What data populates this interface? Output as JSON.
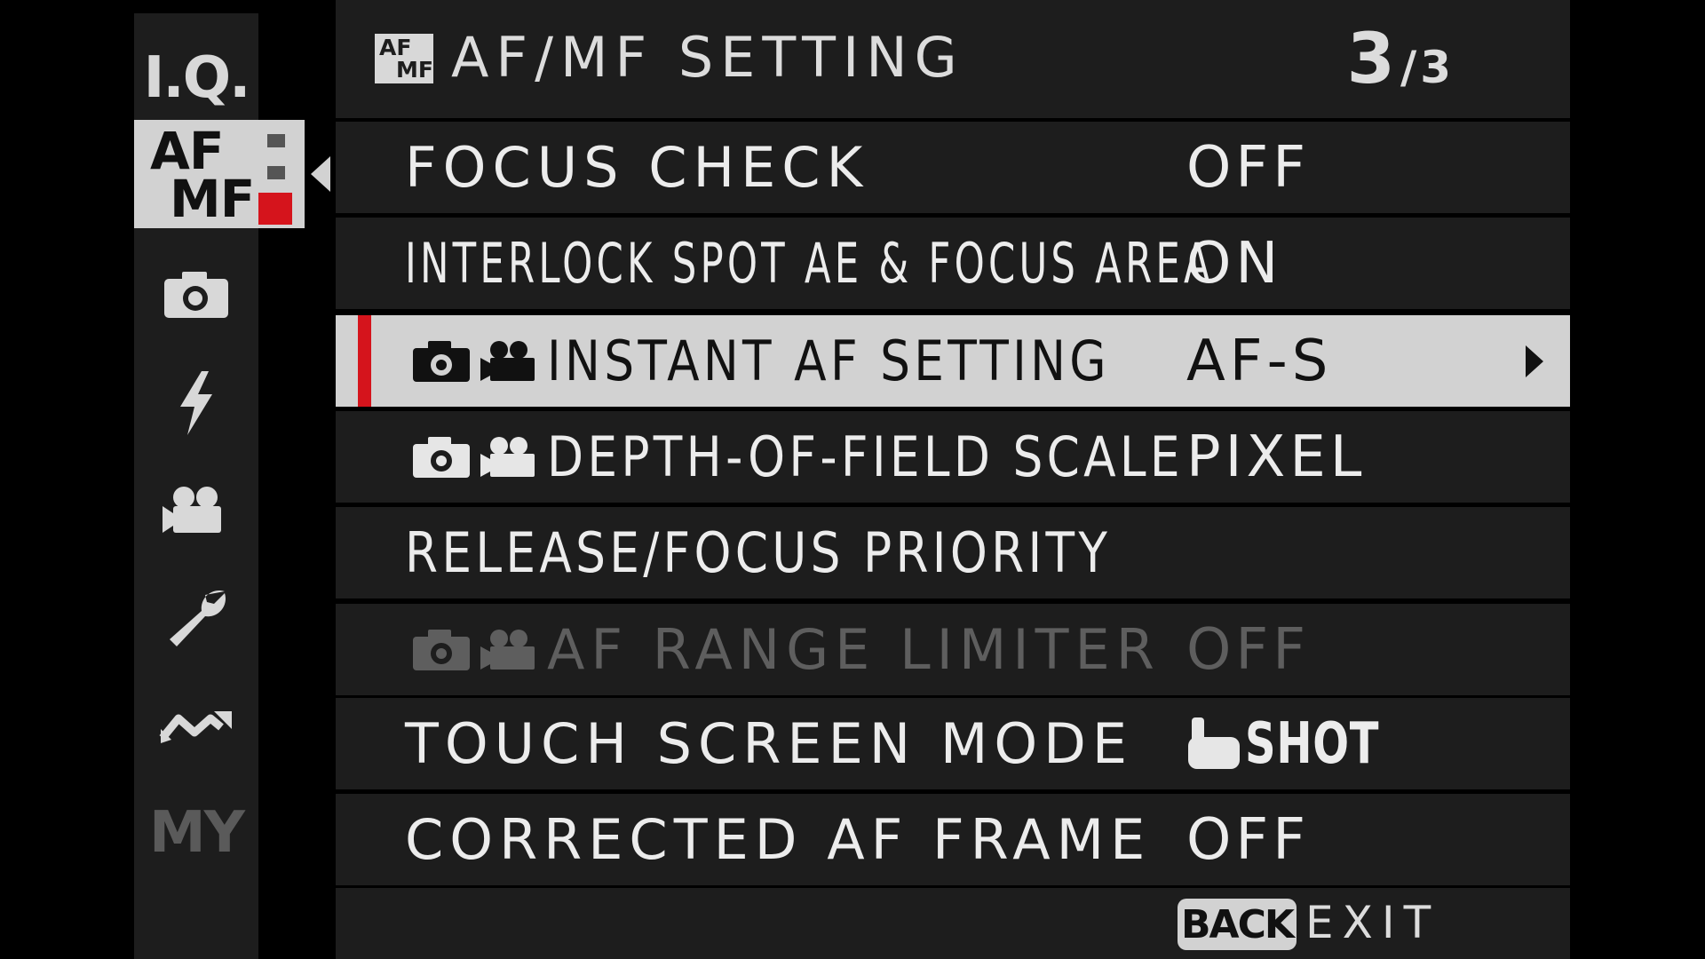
{
  "sidebar": {
    "tabs": [
      {
        "id": "iq",
        "label": "I.Q."
      },
      {
        "id": "afmf",
        "label_top": "AF",
        "label_bottom": "MF",
        "active": true
      },
      {
        "id": "shooting",
        "icon": "camera-icon"
      },
      {
        "id": "flash",
        "icon": "flash-icon"
      },
      {
        "id": "movie",
        "icon": "movie-camera-icon"
      },
      {
        "id": "setup",
        "icon": "wrench-icon"
      },
      {
        "id": "connection",
        "icon": "connection-icon"
      },
      {
        "id": "my",
        "label": "MY"
      }
    ]
  },
  "header": {
    "icon_top": "AF",
    "icon_bottom": "MF",
    "title": "AF/MF SETTING",
    "page_current": "3",
    "page_separator": "/",
    "page_total": "3"
  },
  "menu": {
    "items": [
      {
        "label": "FOCUS CHECK",
        "value": "OFF"
      },
      {
        "label": "INTERLOCK SPOT AE & FOCUS AREA",
        "value": "ON"
      },
      {
        "label": "INSTANT AF SETTING",
        "value": "AF-S",
        "selected": true,
        "mode_icons": [
          "camera-icon",
          "movie-camera-icon"
        ]
      },
      {
        "label": "DEPTH-OF-FIELD SCALE",
        "value": "PIXEL",
        "mode_icons": [
          "camera-icon",
          "movie-camera-icon"
        ]
      },
      {
        "label": "RELEASE/FOCUS PRIORITY",
        "value": ""
      },
      {
        "label": "AF RANGE LIMITER",
        "value": "OFF",
        "disabled": true,
        "mode_icons": [
          "camera-icon",
          "movie-camera-icon"
        ]
      },
      {
        "label": "TOUCH SCREEN MODE",
        "value": "SHOT",
        "value_icon": "touch-hand-icon"
      },
      {
        "label": "CORRECTED AF FRAME",
        "value": "OFF"
      }
    ]
  },
  "footer": {
    "back_label": "BACK",
    "exit_label": "EXIT"
  },
  "colors": {
    "background": "#000000",
    "panel": "#1d1d1d",
    "selected_row": "#d2d2d2",
    "accent_red": "#d5141c",
    "disabled_text": "#5e5e5e"
  }
}
